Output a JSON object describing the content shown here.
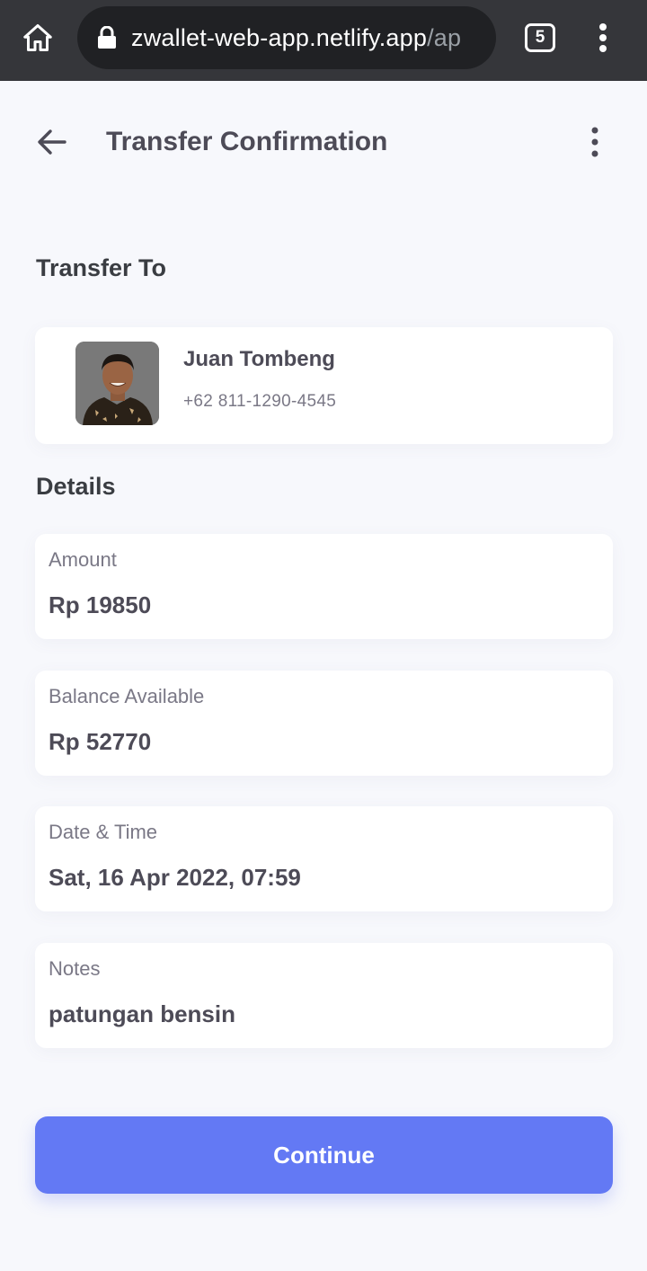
{
  "browser": {
    "url_main": "zwallet-web-app.netlify.app",
    "url_rest": "/ap",
    "tab_count": "5"
  },
  "header": {
    "title": "Transfer Confirmation"
  },
  "transfer_to": {
    "section_title": "Transfer To",
    "recipient_name": "Juan Tombeng",
    "recipient_phone": "+62 811-1290-4545"
  },
  "details": {
    "section_title": "Details",
    "items": [
      {
        "label": "Amount",
        "value": "Rp 19850"
      },
      {
        "label": "Balance Available",
        "value": "Rp 52770"
      },
      {
        "label": "Date & Time",
        "value": "Sat, 16 Apr 2022, 07:59"
      },
      {
        "label": "Notes",
        "value": "patungan bensin"
      }
    ]
  },
  "actions": {
    "continue_label": "Continue"
  },
  "colors": {
    "accent": "#6379f4",
    "background": "#f7f8fc",
    "browser_bar": "#35363a"
  }
}
